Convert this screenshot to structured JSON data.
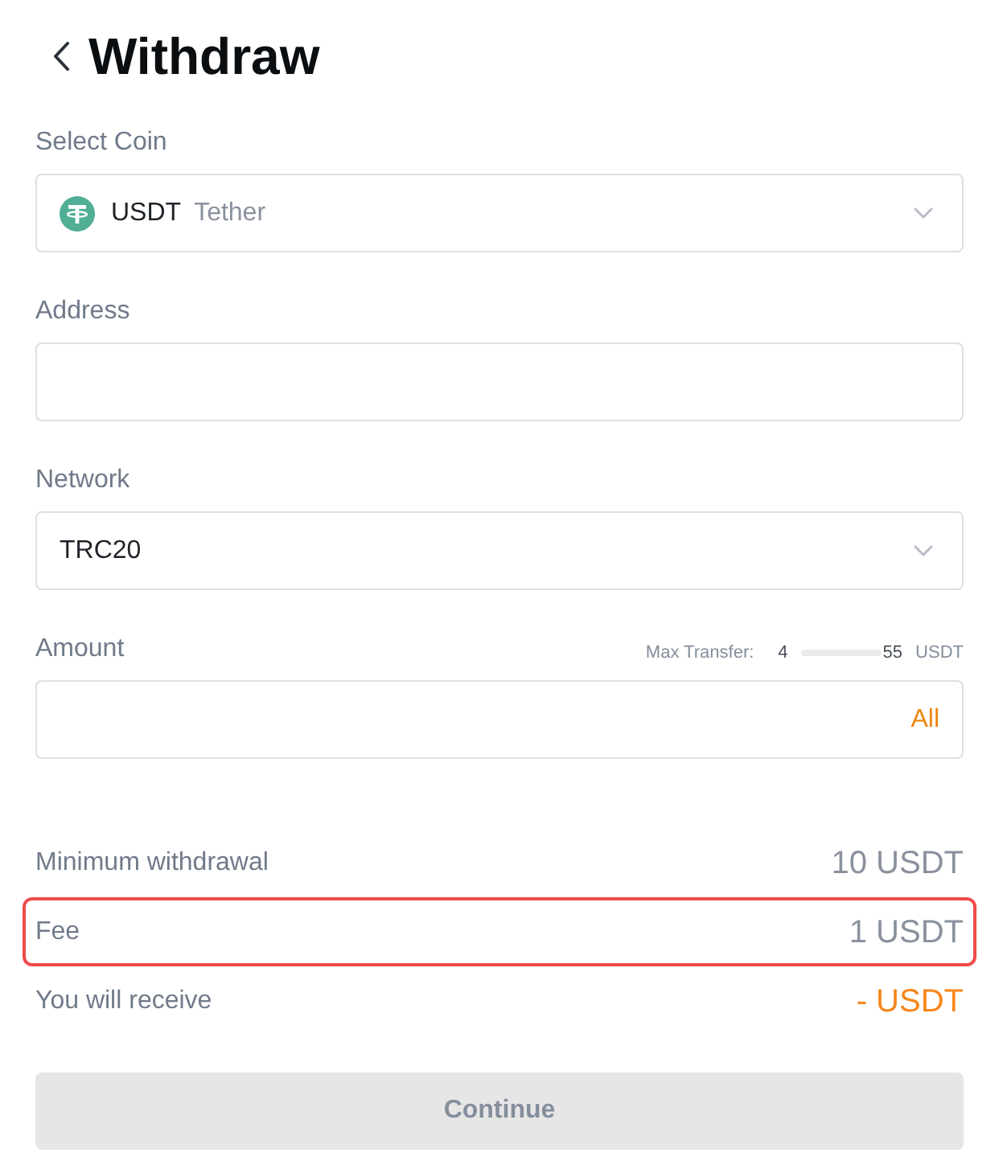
{
  "header": {
    "title": "Withdraw"
  },
  "fields": [
    {
      "kind": "select",
      "label": "Select Coin",
      "coin_icon": true,
      "value": "USDT",
      "secondary": "Tether"
    },
    {
      "kind": "input",
      "label": "Address"
    },
    {
      "kind": "select",
      "label": "Network",
      "value": "TRC20"
    },
    {
      "kind": "input",
      "label": "Amount",
      "hint": {
        "label": "Max Transfer:",
        "value_start": "4",
        "value_end": "55",
        "unit": "USDT",
        "redacted": true
      },
      "action": "All"
    }
  ],
  "summary": [
    {
      "label": "Minimum withdrawal",
      "value": "10 USDT",
      "accent": false,
      "outlined": false
    },
    {
      "label": "Fee",
      "value": "1 USDT",
      "accent": false,
      "outlined": true
    },
    {
      "label": "You will receive",
      "value": "- USDT",
      "accent": true,
      "outlined": false
    }
  ],
  "button": {
    "label": "Continue",
    "disabled": true
  }
}
